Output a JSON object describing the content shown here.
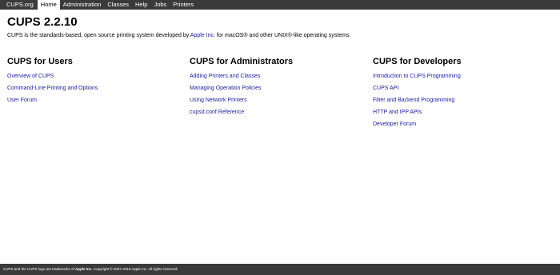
{
  "nav": {
    "items": [
      {
        "label": "CUPS.org"
      },
      {
        "label": "Home"
      },
      {
        "label": "Administration"
      },
      {
        "label": "Classes"
      },
      {
        "label": "Help"
      },
      {
        "label": "Jobs"
      },
      {
        "label": "Printers"
      }
    ],
    "active": "Home"
  },
  "page": {
    "title": "CUPS 2.2.10",
    "intro": {
      "before": "CUPS is the standards-based, open source printing system developed by ",
      "link": "Apple Inc.",
      "after": " for macOS® and other UNIX®-like operating systems."
    }
  },
  "sections": [
    {
      "heading": "CUPS for Users",
      "links": [
        "Overview of CUPS",
        "Command-Line Printing and Options",
        "User Forum"
      ]
    },
    {
      "heading": "CUPS for Administrators",
      "links": [
        "Adding Printers and Classes",
        "Managing Operation Policies",
        "Using Network Printers",
        "cupsd.conf Reference"
      ]
    },
    {
      "heading": "CUPS for Developers",
      "links": [
        "Introduction to CUPS Programming",
        "CUPS API",
        "Filter and Backend Programming",
        "HTTP and IPP APIs",
        "Developer Forum"
      ]
    }
  ],
  "footer": {
    "before": "CUPS and the CUPS logo are trademarks of ",
    "company": "Apple Inc.",
    "after": " Copyright © 2007-2018 Apple Inc. All rights reserved."
  },
  "colors": {
    "bar": "#3a3a3a",
    "link": "#1a1aa6",
    "background": "#ffffff"
  }
}
